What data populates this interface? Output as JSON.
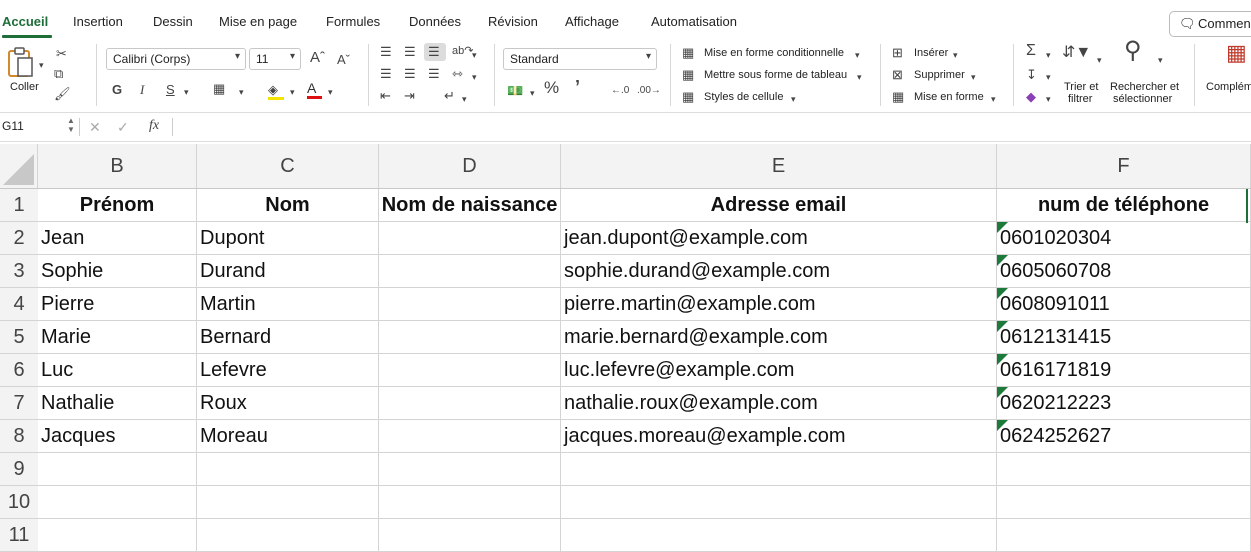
{
  "tabs": [
    "Accueil",
    "Insertion",
    "Dessin",
    "Mise en page",
    "Formules",
    "Données",
    "Révision",
    "Affichage",
    "Automatisation"
  ],
  "comment_label": "Commen",
  "ribbon": {
    "paste_label": "Coller",
    "font_name": "Calibri (Corps)",
    "font_size": "11",
    "number_format": "Standard",
    "cond_format": "Mise en forme conditionnelle",
    "table_format": "Mettre sous forme de tableau",
    "cell_styles": "Styles de cellule",
    "insert": "Insérer",
    "delete": "Supprimer",
    "format": "Mise en forme",
    "sort_filter": [
      "Trier et",
      "filtrer"
    ],
    "find_select": [
      "Rechercher et",
      "sélectionner"
    ],
    "addins": "Complém",
    "bold": "G",
    "italic": "I",
    "underline": "S"
  },
  "formula": {
    "name_box": "G11",
    "formula": ""
  },
  "columns": [
    "B",
    "C",
    "D",
    "E",
    "F"
  ],
  "rows": [
    {
      "n": "1",
      "cells": [
        "Prénom",
        "Nom",
        "Nom de naissance",
        "Adresse email",
        "num de téléphone"
      ]
    },
    {
      "n": "2",
      "cells": [
        "Jean",
        "Dupont",
        "",
        "jean.dupont@example.com",
        "0601020304"
      ]
    },
    {
      "n": "3",
      "cells": [
        "Sophie",
        "Durand",
        "",
        "sophie.durand@example.com",
        "0605060708"
      ]
    },
    {
      "n": "4",
      "cells": [
        "Pierre",
        "Martin",
        "",
        "pierre.martin@example.com",
        "0608091011"
      ]
    },
    {
      "n": "5",
      "cells": [
        "Marie",
        "Bernard",
        "",
        "marie.bernard@example.com",
        "0612131415"
      ]
    },
    {
      "n": "6",
      "cells": [
        "Luc",
        "Lefevre",
        "",
        "luc.lefevre@example.com",
        "0616171819"
      ]
    },
    {
      "n": "7",
      "cells": [
        "Nathalie",
        "Roux",
        "",
        "nathalie.roux@example.com",
        "0620212223"
      ]
    },
    {
      "n": "8",
      "cells": [
        "Jacques",
        "Moreau",
        "",
        "jacques.moreau@example.com",
        "0624252627"
      ]
    },
    {
      "n": "9",
      "cells": [
        "",
        "",
        "",
        "",
        ""
      ]
    },
    {
      "n": "10",
      "cells": [
        "",
        "",
        "",
        "",
        ""
      ]
    },
    {
      "n": "11",
      "cells": [
        "",
        "",
        "",
        "",
        ""
      ]
    }
  ],
  "colors": {
    "accent": "#1e6e3a",
    "warning_triangle": "#1e7a3a",
    "header_bg": "#f3f3f3",
    "gridline": "#d4d4d4"
  }
}
